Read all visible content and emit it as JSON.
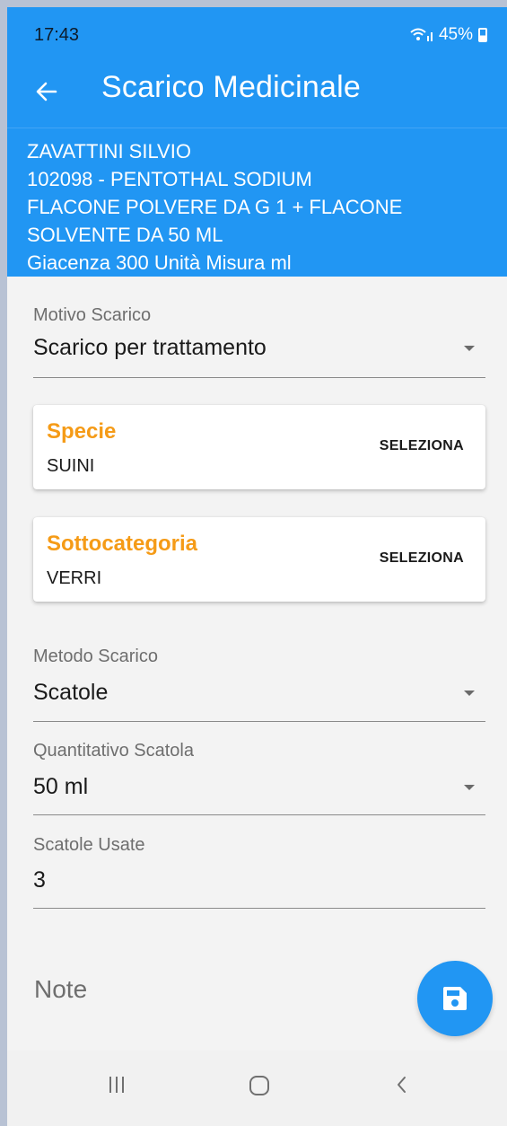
{
  "status_bar": {
    "time": "17:43",
    "battery": "45%",
    "icons": [
      "wifi-icon",
      "signal-icon",
      "battery-icon"
    ]
  },
  "app_bar": {
    "title": "Scarico Medicinale",
    "back_icon": "arrow-back-icon"
  },
  "info": {
    "lines": [
      "ZAVATTINI SILVIO",
      "102098 - PENTOTHAL SODIUM",
      "FLACONE POLVERE DA G 1 + FLACONE",
      "SOLVENTE DA 50 ML",
      "Giacenza  300 Unità Misura  ml"
    ]
  },
  "form": {
    "motivo_scarico": {
      "label": "Motivo Scarico",
      "value": "Scarico per trattamento"
    },
    "specie": {
      "title": "Specie",
      "value": "SUINI",
      "button": "SELEZIONA"
    },
    "sottocategoria": {
      "title": "Sottocategoria",
      "value": "VERRI",
      "button": "SELEZIONA"
    },
    "metodo_scarico": {
      "label": "Metodo Scarico",
      "value": "Scatole"
    },
    "quantitativo_scatola": {
      "label": "Quantitativo Scatola",
      "value": "50 ml"
    },
    "scatole_usate": {
      "label": "Scatole Usate",
      "value": "3"
    },
    "note": {
      "label": "Note"
    }
  },
  "fab": {
    "icon": "save-icon"
  },
  "nav_bar": {
    "icons": [
      "recent-apps-icon",
      "home-icon",
      "back-icon"
    ]
  },
  "colors": {
    "primary": "#2196f3",
    "accent": "#f59b17",
    "background": "#f3f3f3"
  }
}
